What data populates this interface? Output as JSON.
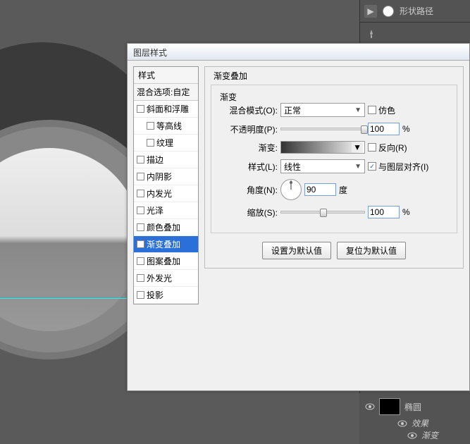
{
  "right_panel": {
    "shape_path": "形状路径",
    "layer_name": "椭圆",
    "fx_label": "效果",
    "fx_sub": "渐变"
  },
  "dialog": {
    "title": "图层样式",
    "style_list": {
      "header": "样式",
      "blend_options": "混合选项:自定",
      "items": [
        {
          "label": "斜面和浮雕",
          "checked": false,
          "indent": false
        },
        {
          "label": "等高线",
          "checked": false,
          "indent": true
        },
        {
          "label": "纹理",
          "checked": false,
          "indent": true
        },
        {
          "label": "描边",
          "checked": false,
          "indent": false
        },
        {
          "label": "内阴影",
          "checked": false,
          "indent": false
        },
        {
          "label": "内发光",
          "checked": false,
          "indent": false
        },
        {
          "label": "光泽",
          "checked": false,
          "indent": false
        },
        {
          "label": "颜色叠加",
          "checked": false,
          "indent": false
        },
        {
          "label": "渐变叠加",
          "checked": true,
          "indent": false,
          "selected": true
        },
        {
          "label": "图案叠加",
          "checked": false,
          "indent": false
        },
        {
          "label": "外发光",
          "checked": false,
          "indent": false
        },
        {
          "label": "投影",
          "checked": false,
          "indent": false
        }
      ]
    },
    "settings": {
      "group_title": "渐变叠加",
      "sub_title": "渐变",
      "blend_mode_label": "混合模式(O):",
      "blend_mode_value": "正常",
      "dither_label": "仿色",
      "opacity_label": "不透明度(P):",
      "opacity_value": "100",
      "percent": "%",
      "gradient_label": "渐变:",
      "reverse_label": "反向(R)",
      "style_label": "样式(L):",
      "style_value": "线性",
      "align_label": "与图层对齐(I)",
      "angle_label": "角度(N):",
      "angle_value": "90",
      "degree": "度",
      "scale_label": "缩放(S):",
      "scale_value": "100",
      "btn_default": "设置为默认值",
      "btn_reset": "复位为默认值"
    }
  }
}
